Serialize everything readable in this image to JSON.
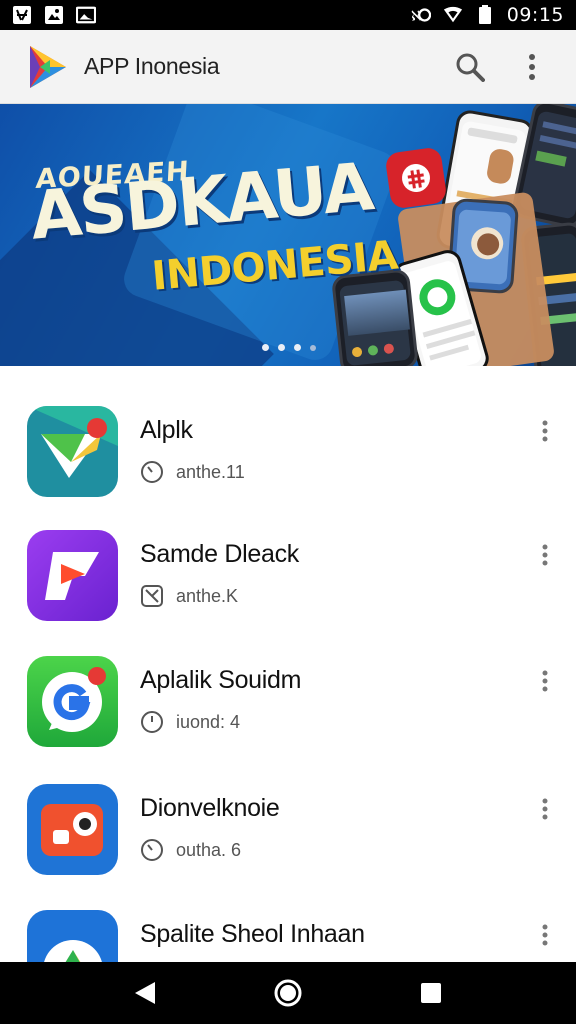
{
  "status_bar": {
    "time": "09:15",
    "left_icons": [
      "notification-icon",
      "photo-icon",
      "gallery-icon"
    ],
    "right_icons": [
      "nfc-icon",
      "wifi-icon",
      "battery-icon"
    ]
  },
  "app_bar": {
    "title": "APP Inonesia",
    "actions": [
      "search-icon",
      "more-vert-icon"
    ]
  },
  "banner": {
    "line1": "AOUEAEH",
    "line2": "ASDKAUA",
    "line3": "INDONESIA",
    "page_count": 4,
    "active_page": 1
  },
  "apps": [
    {
      "name": "Alplk",
      "meta": "anthe.11",
      "meta_icon": "clock-icon",
      "icon": "app-green-icon"
    },
    {
      "name": "Samde Dleack",
      "meta": "anthe.K",
      "meta_icon": "checkbox-icon",
      "icon": "app-purple-icon"
    },
    {
      "name": "Aplalik Souidm",
      "meta": "iuond: 4",
      "meta_icon": "clock-icon",
      "icon": "app-google-icon"
    },
    {
      "name": "Dionvelknoie",
      "meta": "outha. 6",
      "meta_icon": "clock-icon",
      "icon": "app-camera-icon"
    },
    {
      "name": "Spalite Sheol Inhaan",
      "meta": "",
      "meta_icon": "",
      "icon": "app-drive-icon"
    }
  ],
  "nav_bar": {
    "buttons": [
      "back-icon",
      "home-icon",
      "recents-icon"
    ]
  },
  "colors": {
    "status_bar": "#000000",
    "app_bar": "#f3f3f3",
    "banner_blue": "#1776c8",
    "banner_yellow": "#f4cf2d"
  }
}
